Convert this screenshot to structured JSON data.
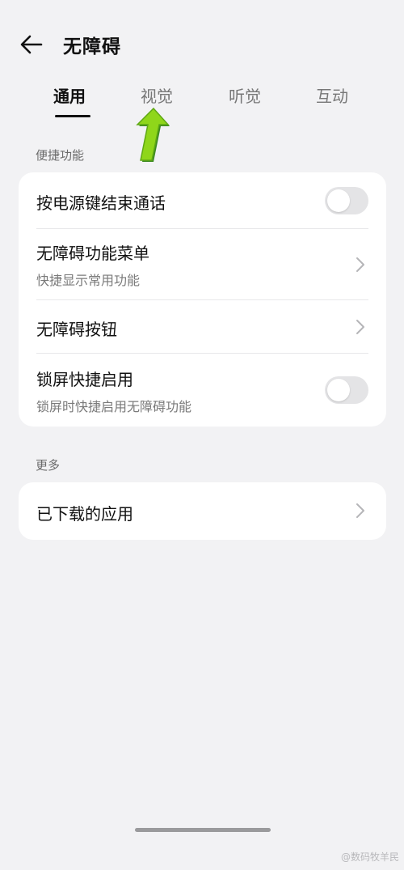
{
  "header": {
    "title": "无障碍",
    "back_icon": "arrow-left-icon"
  },
  "tabs": [
    {
      "label": "通用",
      "active": true
    },
    {
      "label": "视觉",
      "active": false
    },
    {
      "label": "听觉",
      "active": false
    },
    {
      "label": "互动",
      "active": false
    }
  ],
  "annotation": {
    "icon": "green-arrow-up-icon",
    "color": "#8fd61a"
  },
  "sections": [
    {
      "header": "便捷功能",
      "items": [
        {
          "title": "按电源键结束通话",
          "control": "toggle",
          "on": false
        },
        {
          "title": "无障碍功能菜单",
          "subtitle": "快捷显示常用功能",
          "control": "chevron"
        },
        {
          "title": "无障碍按钮",
          "control": "chevron"
        },
        {
          "title": "锁屏快捷启用",
          "subtitle": "锁屏时快捷启用无障碍功能",
          "control": "toggle",
          "on": false
        }
      ]
    },
    {
      "header": "更多",
      "items": [
        {
          "title": "已下载的应用",
          "control": "chevron"
        }
      ]
    }
  ],
  "watermark": "@数码牧羊民",
  "colors": {
    "background": "#f2f2f4",
    "card": "#ffffff",
    "toggle_off": "#e4e4e6",
    "text_primary": "#111111",
    "text_secondary": "#7a7a7a"
  }
}
